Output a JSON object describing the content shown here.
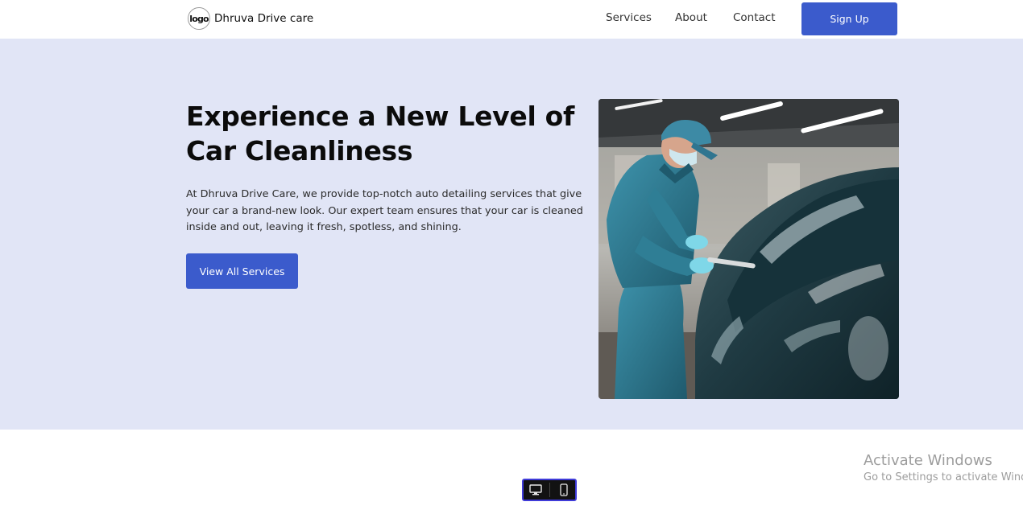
{
  "header": {
    "logo_text": "logo",
    "brand_name": "Dhruva Drive care",
    "nav": {
      "services": "Services",
      "about": "About",
      "contact": "Contact"
    },
    "signup_label": "Sign Up"
  },
  "hero": {
    "title_line1": "Experience a New Level of",
    "title_line2": "Car Cleanliness",
    "description": "At Dhruva Drive Care, we provide top-notch auto detailing services that give your car a brand-new look. Our expert team ensures that your car is cleaned inside and out, leaving it fresh, spotless, and shining.",
    "cta_label": "View All Services",
    "image_subject": "auto-detailing-worker-polishing-car"
  },
  "watermark": {
    "title": "Activate Windows",
    "subtitle": "Go to Settings to activate Windows."
  },
  "device_toggle": {
    "options": [
      "desktop-icon",
      "mobile-icon"
    ]
  },
  "colors": {
    "accent": "#3b5bcc",
    "hero_bg": "#e1e5f6",
    "toggle_border": "#3f3bd8"
  }
}
